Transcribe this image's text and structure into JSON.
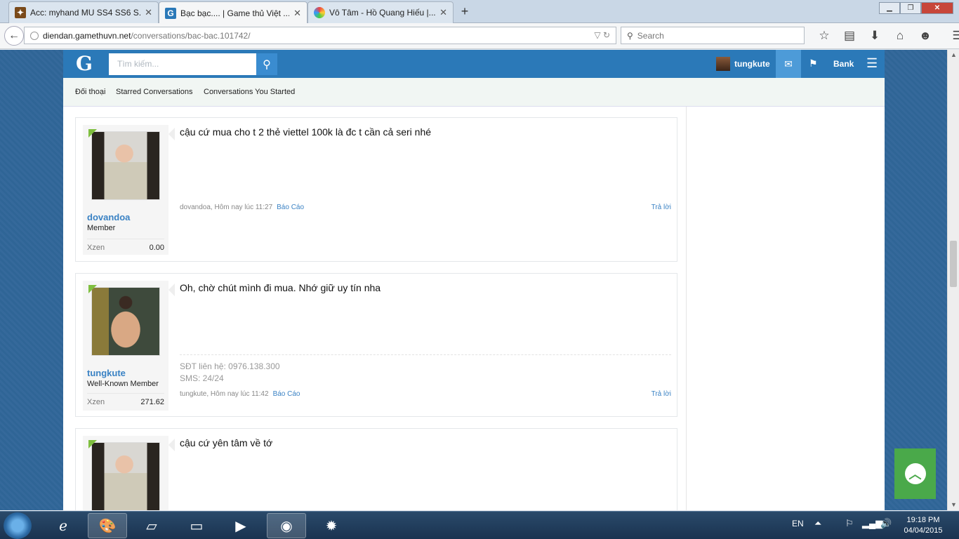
{
  "browser": {
    "tabs": [
      {
        "title": "Acc: myhand MU SS4 SS6 S...",
        "active": false
      },
      {
        "title": "Bạc bạc.... | Game thủ Việt ...",
        "active": true
      },
      {
        "title": "Vô Tâm - Hồ Quang Hiếu |...",
        "active": false
      }
    ],
    "url_domain": "diendan.gamethuvn.net",
    "url_path": "/conversations/bac-bac.101742/",
    "search_placeholder": "Search"
  },
  "forum": {
    "logo": "G",
    "search_placeholder": "Tìm kiếm...",
    "username": "tungkute",
    "bank_label": "Bank",
    "subnav": [
      "Đối thoại",
      "Starred Conversations",
      "Conversations You Started"
    ]
  },
  "messages": [
    {
      "author": "dovandoa",
      "rank": "Member",
      "xzen_label": "Xzen",
      "xzen": "0.00",
      "text": "cậu cứ mua cho t 2 thẻ viettel 100k là đc t cần cả seri nhé",
      "meta": "dovandoa, Hôm nay lúc 11:27",
      "report": "Báo Cáo",
      "reply": "Trả lời"
    },
    {
      "author": "tungkute",
      "rank": "Well-Known Member",
      "xzen_label": "Xzen",
      "xzen": "271.62",
      "text": "Oh, chờ chút mình đi mua. Nhớ giữ uy tín nha",
      "signature": [
        "SĐT liên hệ: 0976.138.300",
        "SMS: 24/24"
      ],
      "meta": "tungkute, Hôm nay lúc 11:42",
      "report": "Báo Cáo",
      "reply": "Trả lời"
    },
    {
      "text": "cậu cứ yên tâm về tớ"
    }
  ],
  "taskbar": {
    "lang": "EN",
    "time": "19:18 PM",
    "date": "04/04/2015"
  }
}
